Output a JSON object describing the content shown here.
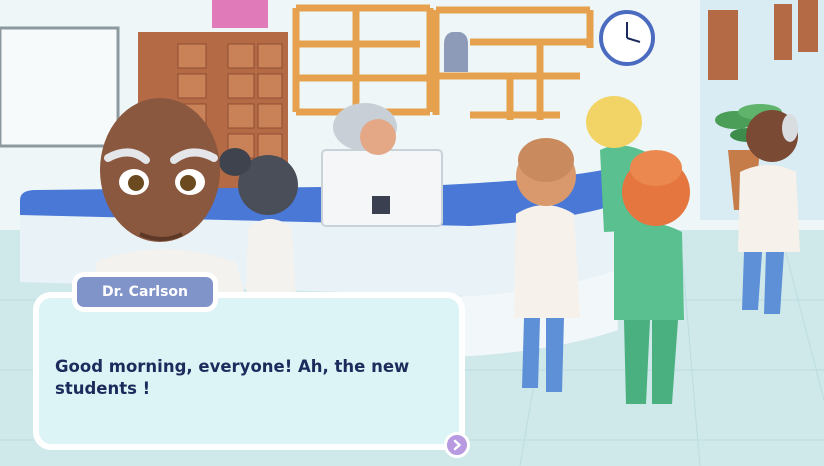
{
  "dialog": {
    "speaker": "Dr. Carlson",
    "text": "Good morning, everyone! Ah, the new students !",
    "next_icon": "chevron-right-icon"
  },
  "colors": {
    "speaker_tab": "#8094c9",
    "dialog_bg": "#dcf4f6",
    "dialog_text": "#1d2b5c",
    "next_button": "#b79ae0"
  }
}
